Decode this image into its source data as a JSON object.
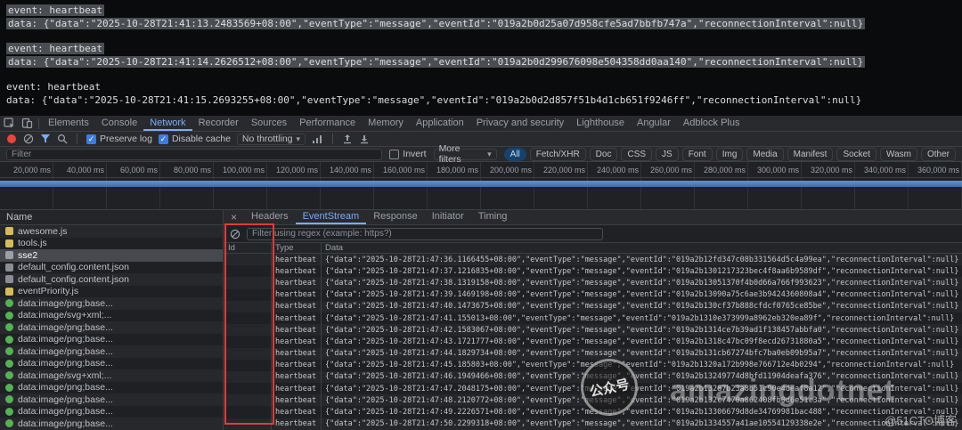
{
  "colors": {
    "accent": "#7cacf8",
    "record_red": "#e8463c",
    "overview_blue": "#4576b4",
    "annotation_red": "#e23b3b",
    "image_icon_green": "#55b155"
  },
  "icons": {
    "tabbar": [
      "inspect-icon",
      "device-toolbar-icon"
    ],
    "network_toolbar": [
      "record-icon",
      "clear-icon",
      "filter-icon",
      "search-icon",
      "network-conditions-icon",
      "export-har-icon",
      "import-har-icon"
    ],
    "eventstream_toolbar": [
      "block-icon"
    ]
  },
  "stream_preview": {
    "lines": [
      {
        "text": "event: heartbeat",
        "highlighted": true
      },
      {
        "text": "data: {\"data\":\"2025-10-28T21:41:13.2483569+08:00\",\"eventType\":\"message\",\"eventId\":\"019a2b0d25a07d958cfe5ad7bbfb747a\",\"reconnectionInterval\":null}",
        "highlighted": true
      },
      {
        "text": "event: heartbeat",
        "highlighted": true
      },
      {
        "text": "data: {\"data\":\"2025-10-28T21:41:14.2626512+08:00\",\"eventType\":\"message\",\"eventId\":\"019a2b0d299676098e504358dd0aa140\",\"reconnectionInterval\":null}",
        "highlighted": true
      },
      {
        "text": "event: heartbeat",
        "highlighted": false
      },
      {
        "text": "data: {\"data\":\"2025-10-28T21:41:15.2693255+08:00\",\"eventType\":\"message\",\"eventId\":\"019a2b0d2d857f51b4d1cb651f9246ff\",\"reconnectionInterval\":null}",
        "highlighted": false
      }
    ]
  },
  "devtools": {
    "panel_tabs": [
      {
        "label": "Elements"
      },
      {
        "label": "Console"
      },
      {
        "label": "Network",
        "active": true
      },
      {
        "label": "Recorder"
      },
      {
        "label": "Sources"
      },
      {
        "label": "Performance"
      },
      {
        "label": "Memory"
      },
      {
        "label": "Application"
      },
      {
        "label": "Privacy and security"
      },
      {
        "label": "Lighthouse"
      },
      {
        "label": "Angular"
      },
      {
        "label": "Adblock Plus"
      }
    ],
    "toolbar": {
      "preserve_log_label": "Preserve log",
      "disable_cache_label": "Disable cache",
      "throttling_value": "No throttling"
    },
    "filter_bar": {
      "filter_placeholder": "Filter",
      "invert_label": "Invert",
      "more_filters_label": "More filters",
      "type_chips": [
        {
          "label": "All",
          "active": true
        },
        {
          "label": "Fetch/XHR"
        },
        {
          "label": "Doc"
        },
        {
          "label": "CSS"
        },
        {
          "label": "JS"
        },
        {
          "label": "Font"
        },
        {
          "label": "Img"
        },
        {
          "label": "Media"
        },
        {
          "label": "Manifest"
        },
        {
          "label": "Socket"
        },
        {
          "label": "Wasm"
        },
        {
          "label": "Other"
        }
      ]
    },
    "timeline_ticks": [
      "20,000 ms",
      "40,000 ms",
      "60,000 ms",
      "80,000 ms",
      "100,000 ms",
      "120,000 ms",
      "140,000 ms",
      "160,000 ms",
      "180,000 ms",
      "200,000 ms",
      "220,000 ms",
      "240,000 ms",
      "260,000 ms",
      "280,000 ms",
      "300,000 ms",
      "320,000 ms",
      "340,000 ms",
      "360,000 ms"
    ],
    "requests": {
      "name_header": "Name",
      "items": [
        {
          "name": "awesome.js",
          "icon": "script"
        },
        {
          "name": "tools.js",
          "icon": "script"
        },
        {
          "name": "sse2",
          "icon": "stream",
          "selected": true
        },
        {
          "name": "default_config.content.json",
          "icon": "json"
        },
        {
          "name": "default_config.content.json",
          "icon": "json"
        },
        {
          "name": "eventPriority.js",
          "icon": "script"
        },
        {
          "name": "data:image/png;base...",
          "icon": "image"
        },
        {
          "name": "data:image/svg+xml;...",
          "icon": "image"
        },
        {
          "name": "data:image/png;base...",
          "icon": "image"
        },
        {
          "name": "data:image/png;base...",
          "icon": "image"
        },
        {
          "name": "data:image/png;base...",
          "icon": "image"
        },
        {
          "name": "data:image/png;base...",
          "icon": "image"
        },
        {
          "name": "data:image/svg+xml;...",
          "icon": "image"
        },
        {
          "name": "data:image/png;base...",
          "icon": "image"
        },
        {
          "name": "data:image/png;base...",
          "icon": "image"
        },
        {
          "name": "data:image/png;base...",
          "icon": "image"
        },
        {
          "name": "data:image/png;base...",
          "icon": "image"
        }
      ]
    },
    "detail": {
      "close_label": "×",
      "tabs": [
        {
          "label": "Headers"
        },
        {
          "label": "EventStream",
          "active": true
        },
        {
          "label": "Response"
        },
        {
          "label": "Initiator"
        },
        {
          "label": "Timing"
        }
      ],
      "filter_placeholder": "Filter using regex (example: https?)",
      "columns": [
        "Id",
        "Type",
        "Data"
      ],
      "events": [
        {
          "id": "",
          "type": "heartbeat",
          "data": "{\"data\":\"2025-10-28T21:47:36.1166455+08:00\",\"eventType\":\"message\",\"eventId\":\"019a2b12fd347c08b331564d5c4a99ea\",\"reconnectionInterval\":null}"
        },
        {
          "id": "",
          "type": "heartbeat",
          "data": "{\"data\":\"2025-10-28T21:47:37.1216835+08:00\",\"eventType\":\"message\",\"eventId\":\"019a2b1301217323bec4f8aa6b9589df\",\"reconnectionInterval\":null}"
        },
        {
          "id": "",
          "type": "heartbeat",
          "data": "{\"data\":\"2025-10-28T21:47:38.1319158+08:00\",\"eventType\":\"message\",\"eventId\":\"019a2b13051370f4b0d66a766f993623\",\"reconnectionInterval\":null}"
        },
        {
          "id": "",
          "type": "heartbeat",
          "data": "{\"data\":\"2025-10-28T21:47:39.1469198+08:00\",\"eventType\":\"message\",\"eventId\":\"019a2b13090a75c6ae3b9424360808a4\",\"reconnectionInterval\":null}"
        },
        {
          "id": "",
          "type": "heartbeat",
          "data": "{\"data\":\"2025-10-28T21:47:40.1473675+08:00\",\"eventType\":\"message\",\"eventId\":\"019a2b130cf37b888cfdcf0765ce85be\",\"reconnectionInterval\":null}"
        },
        {
          "id": "",
          "type": "heartbeat",
          "data": "{\"data\":\"2025-10-28T21:47:41.155013+08:00\",\"eventType\":\"message\",\"eventId\":\"019a2b1310e373999a8962eb320ea89f\",\"reconnectionInterval\":null}"
        },
        {
          "id": "",
          "type": "heartbeat",
          "data": "{\"data\":\"2025-10-28T21:47:42.1583067+08:00\",\"eventType\":\"message\",\"eventId\":\"019a2b1314ce7b39ad1f138457abbfa0\",\"reconnectionInterval\":null}"
        },
        {
          "id": "",
          "type": "heartbeat",
          "data": "{\"data\":\"2025-10-28T21:47:43.1721777+08:00\",\"eventType\":\"message\",\"eventId\":\"019a2b1318c47bc09f8ecd26731880a5\",\"reconnectionInterval\":null}"
        },
        {
          "id": "",
          "type": "heartbeat",
          "data": "{\"data\":\"2025-10-28T21:47:44.1829734+08:00\",\"eventType\":\"message\",\"eventId\":\"019a2b131cb67274bfc7ba0eb09b95a7\",\"reconnectionInterval\":null}"
        },
        {
          "id": "",
          "type": "heartbeat",
          "data": "{\"data\":\"2025-10-28T21:47:45.185803+08:00\",\"eventType\":\"message\",\"eventId\":\"019a2b1320a172b998e766712e4b0294\",\"reconnectionInterval\":null}"
        },
        {
          "id": "",
          "type": "heartbeat",
          "data": "{\"data\":\"2025-10-28T21:47:46.1949466+08:00\",\"eventType\":\"message\",\"eventId\":\"019a2b13249774d8bfd11904deafa376\",\"reconnectionInterval\":null}"
        },
        {
          "id": "",
          "type": "heartbeat",
          "data": "{\"data\":\"2025-10-28T21:47:47.2048175+08:00\",\"eventType\":\"message\",\"eventId\":\"019a2b13287b23a8b51c90e4deaf8a12\",\"reconnectionInterval\":null}"
        },
        {
          "id": "",
          "type": "heartbeat",
          "data": "{\"data\":\"2025-10-28T21:47:48.2120772+08:00\",\"eventType\":\"message\",\"eventId\":\"019a2b132c7470a862408fb0d6e51c3a\",\"reconnectionInterval\":null}"
        },
        {
          "id": "",
          "type": "heartbeat",
          "data": "{\"data\":\"2025-10-28T21:47:49.2226571+08:00\",\"eventType\":\"message\",\"eventId\":\"019a2b13306679d8de34769981bac488\",\"reconnectionInterval\":null}"
        },
        {
          "id": "",
          "type": "heartbeat",
          "data": "{\"data\":\"2025-10-28T21:47:50.2299318+08:00\",\"eventType\":\"message\",\"eventId\":\"019a2b1334557a41ae10554129338e2e\",\"reconnectionInterval\":null}"
        }
      ]
    }
  },
  "watermark": {
    "badge_text": "公众号",
    "brand": "amazingdotnet",
    "credit": "@51CTO博客"
  }
}
